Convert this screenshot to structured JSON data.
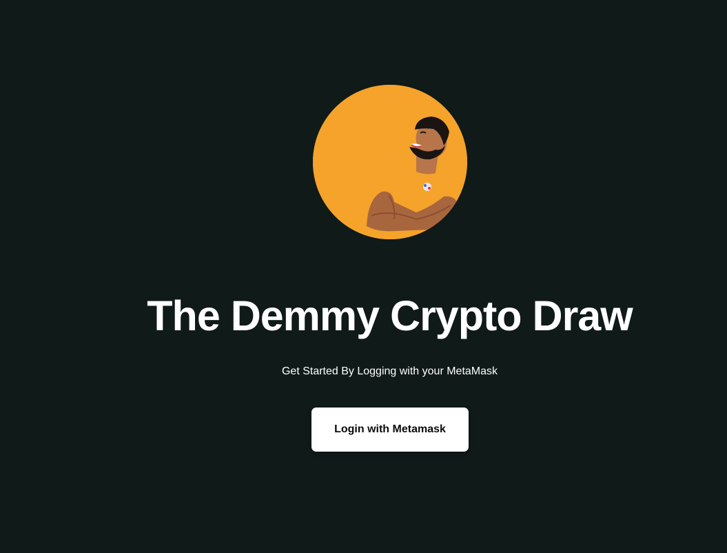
{
  "hero": {
    "title": "The Demmy Crypto Draw",
    "subtitle": "Get Started By Logging with your MetaMask",
    "login_button_label": "Login with Metamask"
  },
  "colors": {
    "background": "#0f1a19",
    "avatar_background": "#f5a32a",
    "button_background": "#ffffff",
    "text": "#ffffff"
  },
  "icons": {
    "avatar": "bearded-man-crossed-arms-illustration"
  }
}
